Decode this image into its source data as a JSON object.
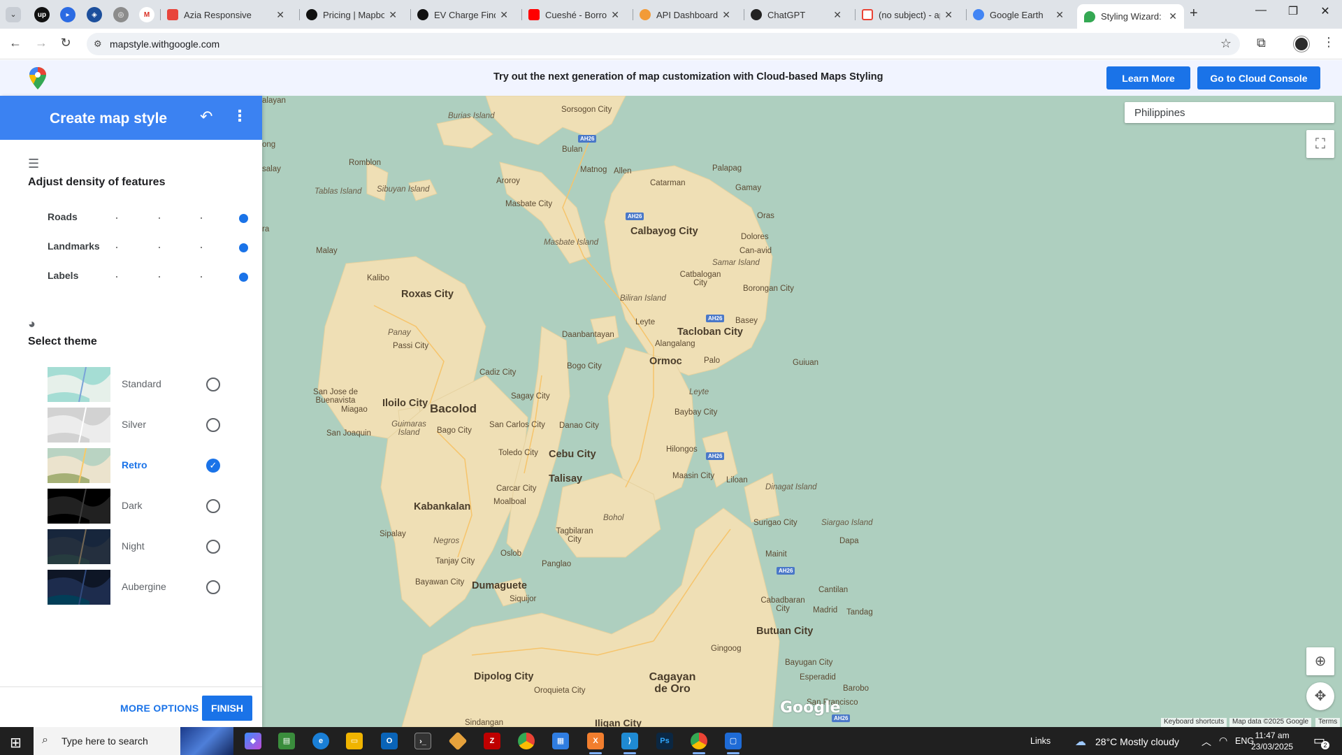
{
  "browser": {
    "tabs": [
      {
        "title": "Azia Responsive",
        "favicon_color": "#e8453c"
      },
      {
        "title": "Pricing | Mapbox",
        "favicon_color": "#111111"
      },
      {
        "title": "EV Charge Finde",
        "favicon_color": "#111111"
      },
      {
        "title": "Cueshé - Borrow",
        "favicon_color": "#ff0000"
      },
      {
        "title": "API Dashboard -",
        "favicon_color": "#f29b38"
      },
      {
        "title": "ChatGPT",
        "favicon_color": "#222222"
      },
      {
        "title": "(no subject) - ap",
        "favicon_color": "#ea4335"
      },
      {
        "title": "Google Earth",
        "favicon_color": "#4285f4"
      },
      {
        "title": "Styling Wizard: C",
        "favicon_color": "#34a853"
      }
    ],
    "url": "mapstyle.withgoogle.com"
  },
  "banner": {
    "text": "Try out the next generation of map customization with Cloud-based Maps Styling",
    "learn_more": "Learn More",
    "cloud_console": "Go to Cloud Console"
  },
  "panel": {
    "title": "Create map style",
    "density_title": "Adjust density of features",
    "sliders": [
      {
        "label": "Roads",
        "level": 1.0
      },
      {
        "label": "Landmarks",
        "level": 1.0
      },
      {
        "label": "Labels",
        "level": 1.0
      }
    ],
    "theme_title": "Select theme",
    "themes": [
      {
        "label": "Standard",
        "selected": false
      },
      {
        "label": "Silver",
        "selected": false
      },
      {
        "label": "Retro",
        "selected": true
      },
      {
        "label": "Dark",
        "selected": false
      },
      {
        "label": "Night",
        "selected": false
      },
      {
        "label": "Aubergine",
        "selected": false
      }
    ],
    "more_options": "MORE OPTIONS",
    "finish": "FINISH"
  },
  "map": {
    "search_value": "Philippines",
    "labels": {
      "big": [
        "Roxas City",
        "Calbayog City",
        "Tacloban City",
        "Ormoc",
        "Iloilo City",
        "Bacolod",
        "Cebu City",
        "Talisay",
        "Kabankalan",
        "Dumaguete",
        "Butuan City",
        "Dipolog City",
        "Cagayan de Oro"
      ],
      "small": [
        "Sorsogon City",
        "Burias Island",
        "Bulan",
        "Matnog",
        "Allen",
        "Romblon",
        "Aroroy",
        "Masbate City",
        "Tablas Island",
        "Sibuyan Island",
        "Catarman",
        "Palapag",
        "Gamay",
        "Oras",
        "Dolores",
        "Can-avid",
        "Samar Island",
        "Malay",
        "Kalibo",
        "Masbate Island",
        "Catbalogan City",
        "Borongan City",
        "Biliran Island",
        "Leyte",
        "Basey",
        "Alangalang",
        "Palo",
        "Panay",
        "Passi City",
        "Daanbantayan",
        "Guiuan",
        "Bogo City",
        "Cadiz City",
        "San Jose de Buenavista",
        "Sagay City",
        "Miagao",
        "Leyte",
        "Baybay City",
        "Guimaras Island",
        "San Carlos City",
        "Danao City",
        "San Joaquin",
        "Bago City",
        "Toledo City",
        "Hilongos",
        "Maasin City",
        "Liloan",
        "Dinagat Island",
        "Carcar City",
        "Moalboal",
        "Bohol",
        "Surigao City",
        "Siargao Island",
        "Dapa",
        "Sipalay",
        "Negros",
        "Tagbilaran City",
        "Mainit",
        "Oslob",
        "Panglao",
        "Tanjay City",
        "Bayawan City",
        "Cantilan",
        "Siquijor",
        "Cabadbaran City",
        "Madrid",
        "Tandag",
        "Gingoog",
        "Bayugan City",
        "Esperadid",
        "Barobo",
        "Oroquieta City",
        "San Francisco",
        "Iligan City",
        "Sindangan",
        "alayan",
        "ong",
        "salay",
        "ra"
      ],
      "shields": [
        "AH26",
        "AH26",
        "AH26",
        "AH26",
        "AH26",
        "AH26"
      ]
    },
    "google": "Google",
    "attribution": {
      "shortcuts": "Keyboard shortcuts",
      "data": "Map data ©2025 Google",
      "terms": "Terms"
    }
  },
  "taskbar": {
    "search_placeholder": "Type here to search",
    "links": "Links",
    "weather": "28°C  Mostly cloudy",
    "lang": "ENG",
    "time": "11:47 am",
    "date": "23/03/2025",
    "notifications": "2"
  }
}
